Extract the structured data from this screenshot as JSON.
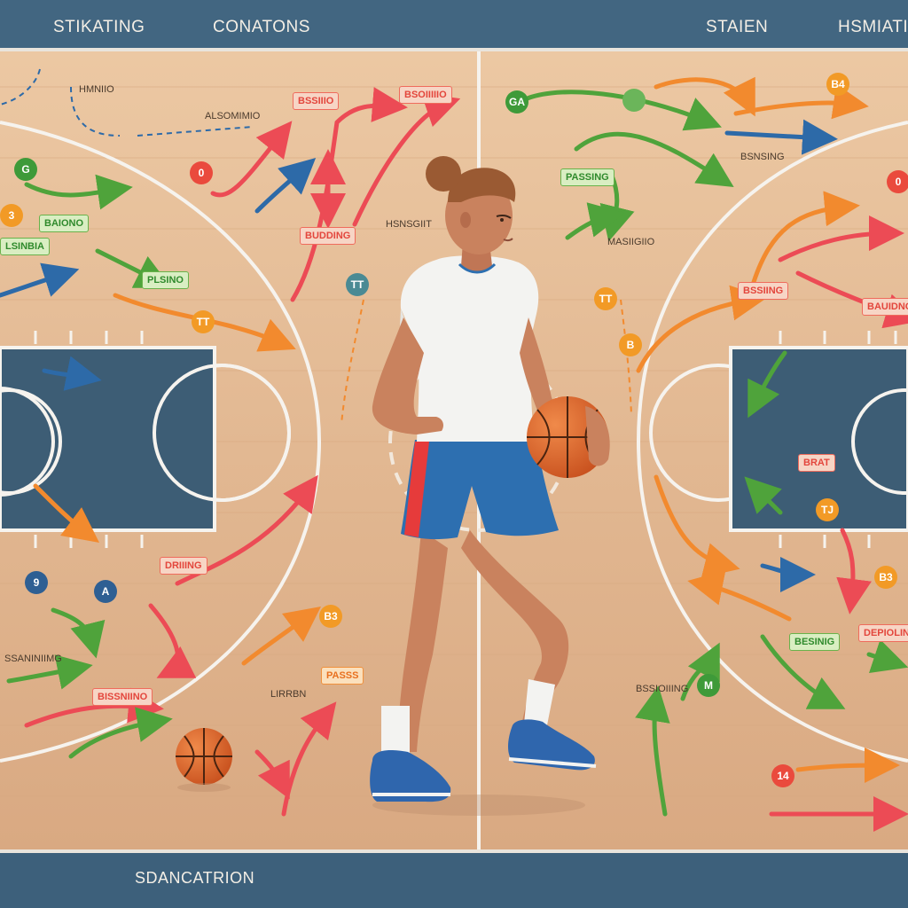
{
  "header": {
    "items": [
      "STIKATING",
      "CONATONS",
      "STAIEN",
      "HSMIATIN"
    ]
  },
  "footer": {
    "title": "SDANCATRION"
  },
  "labels": [
    "HMNIIO",
    "ALSOMIMIO",
    "BSSIIIO",
    "BSOIIIIIO",
    "BAIONO",
    "LSINBIA",
    "PLSINO",
    "BUDDING",
    "HSNSGIIT",
    "DRIIING",
    "SSANINIIMG",
    "BISSNIINO",
    "LIRRBN",
    "PASSS",
    "PASSING",
    "BSNSING",
    "MASIIGIIO",
    "BSSIING",
    "BAUIDNG",
    "BRAT",
    "BESINIG",
    "DEPIOLINE",
    "BSSIOIIING"
  ],
  "badges": [
    "G",
    "3",
    "0",
    "TT",
    "TT",
    "9",
    "A",
    "B3",
    "GA",
    "",
    "B4",
    "TT",
    "B",
    "0",
    "TJ",
    "B3",
    "M",
    "14"
  ],
  "colors": {
    "court": "#e2b892",
    "paint": "#3d5d75",
    "line": "#f6f3ee",
    "shirt": "#f3f3f1",
    "shorts": "#2d6fb0",
    "ball": "#d9622b",
    "skin": "#c9825e",
    "hair": "#9a5a33",
    "shoes": "#2f66ad"
  }
}
